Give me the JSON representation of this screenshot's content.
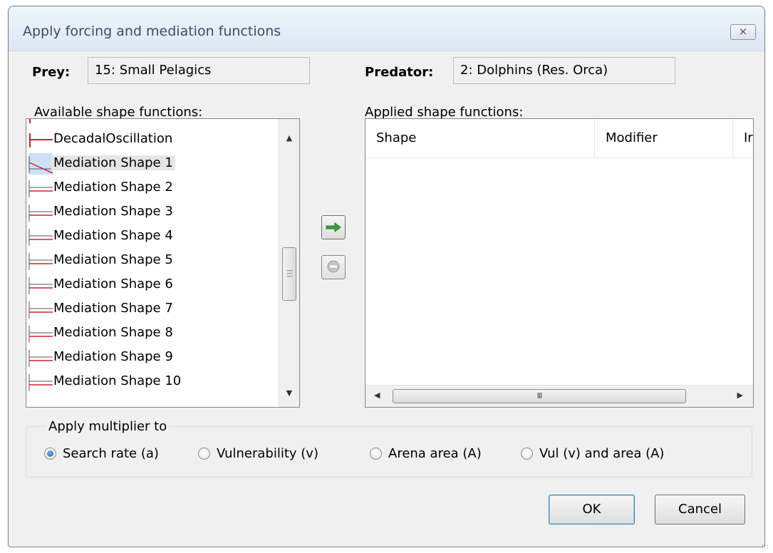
{
  "window": {
    "title": "Apply forcing and mediation functions",
    "close_glyph": "⨯"
  },
  "prey": {
    "label": "Prey:",
    "value": "15: Small Pelagics"
  },
  "predator": {
    "label": "Predator:",
    "value": "2: Dolphins (Res. Orca)"
  },
  "available": {
    "label": "Available shape functions:",
    "items": [
      {
        "label": "DecadalOscillation",
        "icon": "forcing-shape-icon"
      },
      {
        "label": "DecadalOscillation",
        "icon": "forcing-shape-icon"
      },
      {
        "label": "Mediation Shape 1",
        "icon": "mediation-shape-icon"
      },
      {
        "label": "Mediation Shape 2",
        "icon": "mediation-shape-icon"
      },
      {
        "label": "Mediation Shape 3",
        "icon": "mediation-shape-icon"
      },
      {
        "label": "Mediation Shape 4",
        "icon": "mediation-shape-icon"
      },
      {
        "label": "Mediation Shape 5",
        "icon": "mediation-shape-icon"
      },
      {
        "label": "Mediation Shape 6",
        "icon": "mediation-shape-icon"
      },
      {
        "label": "Mediation Shape 7",
        "icon": "mediation-shape-icon"
      },
      {
        "label": "Mediation Shape 8",
        "icon": "mediation-shape-icon"
      },
      {
        "label": "Mediation Shape 9",
        "icon": "mediation-shape-icon"
      },
      {
        "label": "Mediation Shape 10",
        "icon": "mediation-shape-icon"
      }
    ],
    "selected_label": "Mediation Shape 1"
  },
  "applied": {
    "label": "Applied shape functions:",
    "columns": [
      "Shape",
      "Modifier",
      "Ir"
    ],
    "scroll_grip": "III"
  },
  "multiplier": {
    "legend": "Apply multiplier to",
    "options": [
      {
        "label": "Search rate (a)",
        "checked": true
      },
      {
        "label": "Vulnerability (v)",
        "checked": false
      },
      {
        "label": "Arena area (A)",
        "checked": false
      },
      {
        "label": "Vul (v) and area (A)",
        "checked": false
      }
    ]
  },
  "buttons": {
    "ok": "OK",
    "cancel": "Cancel"
  },
  "colors": {
    "accent_red": "#d0222b",
    "selection": "#cce1f7",
    "arrow_green": "#3aa03a"
  }
}
